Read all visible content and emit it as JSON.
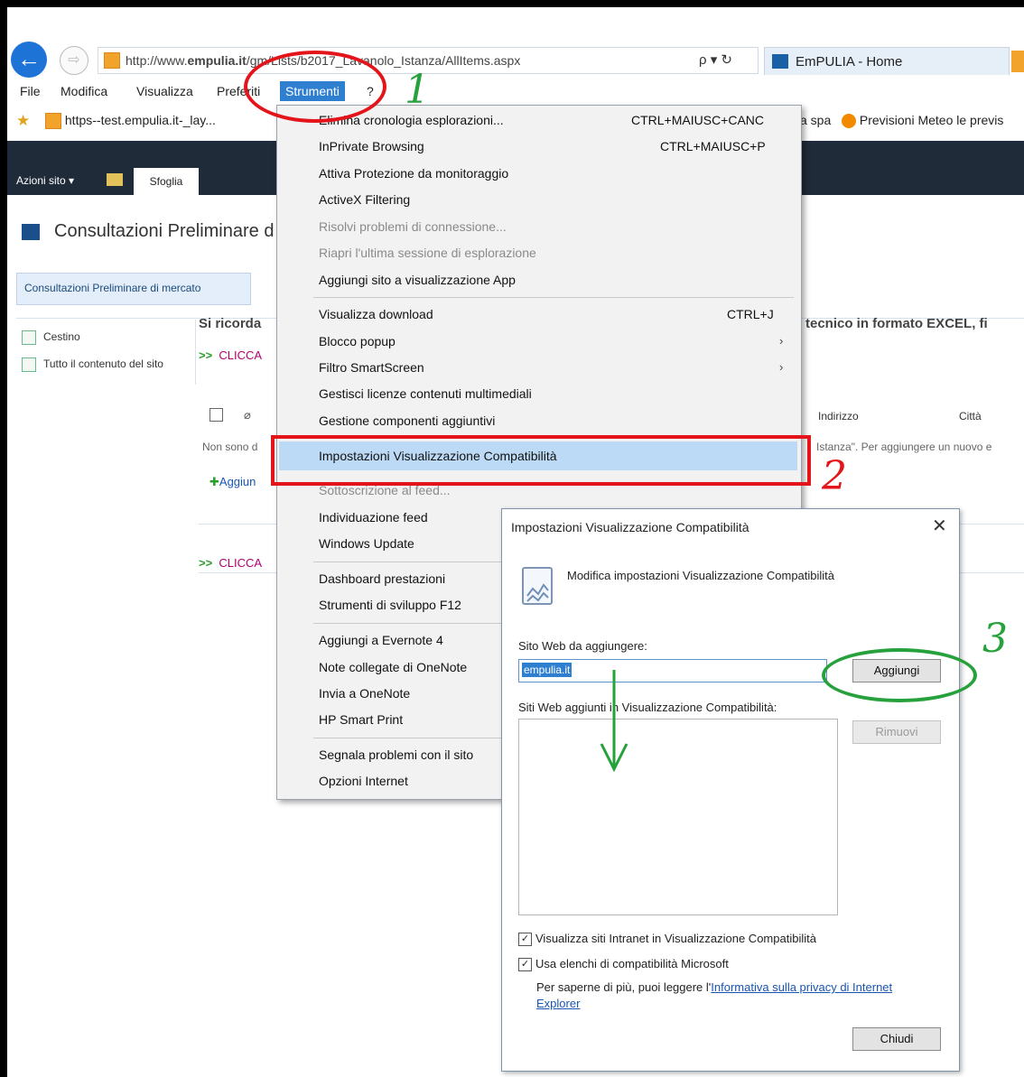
{
  "browser": {
    "address": {
      "prefix": "http://www.",
      "domain": "empulia.it",
      "path": "/gm/Lists/b2017_Lavanolo_Istanza/AllItems.aspx",
      "tools": "ρ ▾ ↻"
    },
    "tab_title": "EmPULIA - Home"
  },
  "menubar": {
    "file": "File",
    "modifica": "Modifica",
    "visualizza": "Visualizza",
    "preferiti": "Preferiti",
    "strumenti": "Strumenti",
    "help": "?"
  },
  "favorites": {
    "item1": "https--test.empulia.it-_lay...",
    "item2": "a spa",
    "item3": "Previsioni Meteo le previs"
  },
  "sharepoint": {
    "azioni_sito": "Azioni sito ▾",
    "tab_sfoglia": "Sfoglia",
    "title": "Consultazioni Preliminare d",
    "nav_label": "Consultazioni Preliminare di mercato",
    "cestino": "Cestino",
    "tutto": "Tutto il contenuto del sito",
    "notice_left": "Si ricorda",
    "notice_right": "tecnico in formato EXCEL, fi",
    "clicca": "CLICCA",
    "col_indirizzo": "Indirizzo",
    "col_citta": "Città",
    "non_sono": "Non sono d",
    "istanza_text": "Istanza\". Per aggiungere un nuovo e",
    "aggiungi_link": "Aggiun"
  },
  "tools_menu": {
    "items": [
      {
        "label": "Elimina cronologia esplorazioni...",
        "shortcut": "CTRL+MAIUSC+CANC"
      },
      {
        "label": "InPrivate Browsing",
        "shortcut": "CTRL+MAIUSC+P"
      },
      {
        "label": "Attiva Protezione da monitoraggio"
      },
      {
        "label": "ActiveX Filtering"
      },
      {
        "label": "Risolvi problemi di connessione..."
      },
      {
        "label": "Riapri l'ultima sessione di esplorazione"
      },
      {
        "label": "Aggiungi sito a visualizzazione App"
      },
      {
        "label": "Visualizza download",
        "shortcut": "CTRL+J"
      },
      {
        "label": "Blocco popup"
      },
      {
        "label": "Filtro SmartScreen"
      },
      {
        "label": "Gestisci licenze contenuti multimediali"
      },
      {
        "label": "Gestione componenti aggiuntivi"
      },
      {
        "label": "Impostazioni Visualizzazione Compatibilità"
      },
      {
        "label": "Sottoscrizione al feed..."
      },
      {
        "label": "Individuazione feed"
      },
      {
        "label": "Windows Update"
      },
      {
        "label": "Dashboard prestazioni"
      },
      {
        "label": "Strumenti di sviluppo F12"
      },
      {
        "label": "Aggiungi a Evernote 4"
      },
      {
        "label": "Note collegate di OneNote"
      },
      {
        "label": "Invia a OneNote"
      },
      {
        "label": "HP Smart Print"
      },
      {
        "label": "Segnala problemi con il sito"
      },
      {
        "label": "Opzioni Internet"
      }
    ]
  },
  "dialog": {
    "title": "Impostazioni Visualizzazione Compatibilità",
    "close": "✕",
    "heading": "Modifica impostazioni Visualizzazione Compatibilità",
    "site_label": "Sito Web da aggiungere:",
    "site_value": "empulia.it",
    "add_button": "Aggiungi",
    "list_label": "Siti Web aggiunti in Visualizzazione Compatibilità:",
    "remove_button": "Rimuovi",
    "check1": "Visualizza siti Intranet in Visualizzazione Compatibilità",
    "check2": "Usa elenchi di compatibilità Microsoft",
    "info_text": "Per saperne di più, puoi leggere l'",
    "info_link1": "Informativa sulla privacy di Internet",
    "info_link2": "Explorer",
    "close_button": "Chiudi"
  },
  "annotations": {
    "step1": "1",
    "step2": "2",
    "step3": "3"
  },
  "colors": {
    "annotation_red": "#e3151a",
    "annotation_green": "#27a13b",
    "highlight": "#bcdaf5",
    "ie_blue": "#2f7fd1"
  }
}
